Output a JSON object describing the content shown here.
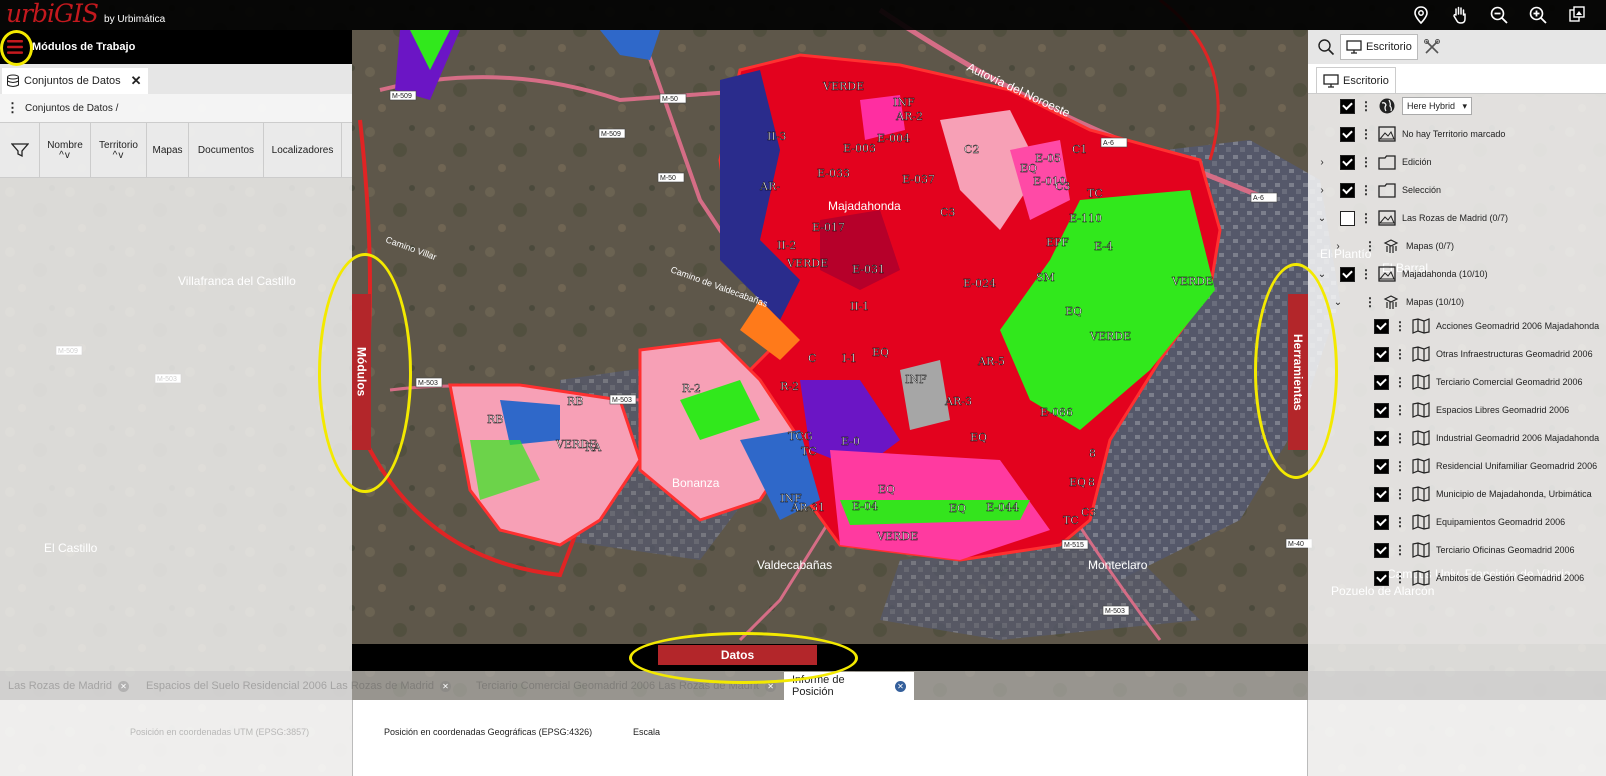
{
  "app": {
    "logo_text": "urbiGIS",
    "logo_by": "by Urbimática"
  },
  "top_tools": [
    {
      "name": "location-pin-icon"
    },
    {
      "name": "hand-pan-icon"
    },
    {
      "name": "zoom-out-icon"
    },
    {
      "name": "zoom-in-icon"
    },
    {
      "name": "layers-gallery-icon"
    }
  ],
  "left_panel": {
    "title": "Módulos de Trabajo",
    "tab": "Conjuntos de Datos",
    "breadcrumb": "Conjuntos de Datos /",
    "columns": [
      {
        "label": "Nombre",
        "sortable": true
      },
      {
        "label": "Territorio",
        "sortable": true
      },
      {
        "label": "Mapas",
        "sortable": false
      },
      {
        "label": "Documentos",
        "sortable": false
      },
      {
        "label": "Localizadores",
        "sortable": false
      }
    ]
  },
  "side_tabs": {
    "modulos": "Módulos",
    "herramientas": "Herramientas",
    "datos": "Datos"
  },
  "right_panel": {
    "escritorio_btn": "Escritorio",
    "tab": "Escritorio",
    "layers": [
      {
        "label": "Here Hybrid",
        "checked": true,
        "expander": "",
        "indent": 0,
        "icon": "globe-icon",
        "is_select": true
      },
      {
        "label": "No hay Territorio marcado",
        "checked": true,
        "expander": "",
        "indent": 0,
        "icon": "image-icon"
      },
      {
        "label": "Edición",
        "checked": true,
        "expander": "›",
        "indent": 0,
        "icon": "folder-icon"
      },
      {
        "label": "Selección",
        "checked": true,
        "expander": "›",
        "indent": 0,
        "icon": "folder-icon"
      },
      {
        "label": "Las Rozas de Madrid (0/7)",
        "checked": false,
        "expander": "⌄",
        "indent": 0,
        "icon": "image-icon"
      },
      {
        "label": "Mapas (0/7)",
        "checked": null,
        "expander": "›",
        "indent": 1,
        "icon": "stack-hand-icon"
      },
      {
        "label": "Majadahonda (10/10)",
        "checked": true,
        "expander": "⌄",
        "indent": 0,
        "icon": "image-icon"
      },
      {
        "label": "Mapas (10/10)",
        "checked": null,
        "expander": "⌄",
        "indent": 1,
        "icon": "stack-hand-icon"
      },
      {
        "label": "Acciones Geomadrid 2006 Majadahonda",
        "checked": true,
        "expander": "",
        "indent": 2,
        "icon": "map-icon"
      },
      {
        "label": "Otras Infraestructuras Geomadrid 2006",
        "checked": true,
        "expander": "",
        "indent": 2,
        "icon": "map-icon"
      },
      {
        "label": "Terciario Comercial Geomadrid 2006",
        "checked": true,
        "expander": "",
        "indent": 2,
        "icon": "map-icon"
      },
      {
        "label": "Espacios Libres Geomadrid 2006",
        "checked": true,
        "expander": "",
        "indent": 2,
        "icon": "map-icon"
      },
      {
        "label": "Industrial Geomadrid 2006 Majadahonda",
        "checked": true,
        "expander": "",
        "indent": 2,
        "icon": "map-icon"
      },
      {
        "label": "Residencial Unifamiliar Geomadrid 2006",
        "checked": true,
        "expander": "",
        "indent": 2,
        "icon": "map-icon"
      },
      {
        "label": "Municipio de Majadahonda, Urbimática",
        "checked": true,
        "expander": "",
        "indent": 2,
        "icon": "map-icon"
      },
      {
        "label": "Equipamientos Geomadrid 2006",
        "checked": true,
        "expander": "",
        "indent": 2,
        "icon": "map-icon"
      },
      {
        "label": "Terciario Oficinas Geomadrid 2006",
        "checked": true,
        "expander": "",
        "indent": 2,
        "icon": "map-icon"
      },
      {
        "label": "Ámbitos de Gestión Geomadrid 2006",
        "checked": true,
        "expander": "",
        "indent": 2,
        "icon": "map-icon"
      }
    ]
  },
  "bottom": {
    "tabs": [
      {
        "label": "Las Rozas de Madrid",
        "active": false
      },
      {
        "label": "Espacios del Suelo Residencial 2006 Las Rozas de Madrid",
        "active": false
      },
      {
        "label": "Terciario Comercial Geomadrid 2006 Las Rozas de Madrid",
        "active": false
      },
      {
        "label": "Informe de Posición",
        "active": true
      }
    ],
    "utm_label": "Posición en coordenadas UTM (EPSG:3857)",
    "geo_label": "Posición en coordenadas Geográficas (EPSG:4326)",
    "scale_label": "Escala"
  },
  "map_labels": {
    "places": [
      "Villafranca del Castillo",
      "El Castillo",
      "Bonanza",
      "Valdecabañas",
      "Monteclaro",
      "Majadahonda",
      "Campus Univ. Francisco de Vitoria",
      "Pozuelo de Alarcón",
      "El Plantío",
      "El Barral",
      "Autovía del Noroeste",
      "Camino Villar",
      "Camino de Valdecabañas"
    ],
    "roads": [
      "M-509",
      "M-50",
      "M-509",
      "M-50",
      "M-503",
      "M-503",
      "M-515",
      "M-503",
      "A-6",
      "A-6",
      "M-40",
      "M-503",
      "M-509"
    ],
    "zones": [
      "VERDE",
      "INF",
      "AR-2",
      "II-3",
      "E-003",
      "E-004",
      "C2",
      "C1",
      "E-037",
      "E-05",
      "EQ",
      "E-010",
      "E-033",
      "AR-",
      "E-017",
      "C3",
      "E-110",
      "TC",
      "VERDE",
      "II-2",
      "E-031",
      "E-024",
      "EPF",
      "E-4",
      "SM",
      "VERDE",
      "II-1",
      "C",
      "I-1",
      "EQ",
      "INF",
      "AR-3",
      "AR-5",
      "E-086",
      "R-2",
      "R-2",
      "RB",
      "RB",
      "VERDE",
      "RA",
      "TCG",
      "TC",
      "EQ",
      "E-0",
      "EQ",
      "INF",
      "AR-31",
      "E-04",
      "EQ",
      "EQ",
      "E-044",
      "TC",
      "C3",
      "VERDE",
      "VERDE",
      "EQ",
      "C3",
      "8",
      "8"
    ]
  },
  "colors": {
    "accent": "#b3262a",
    "highlight": "#f3e900",
    "boundary": "#e02424"
  }
}
